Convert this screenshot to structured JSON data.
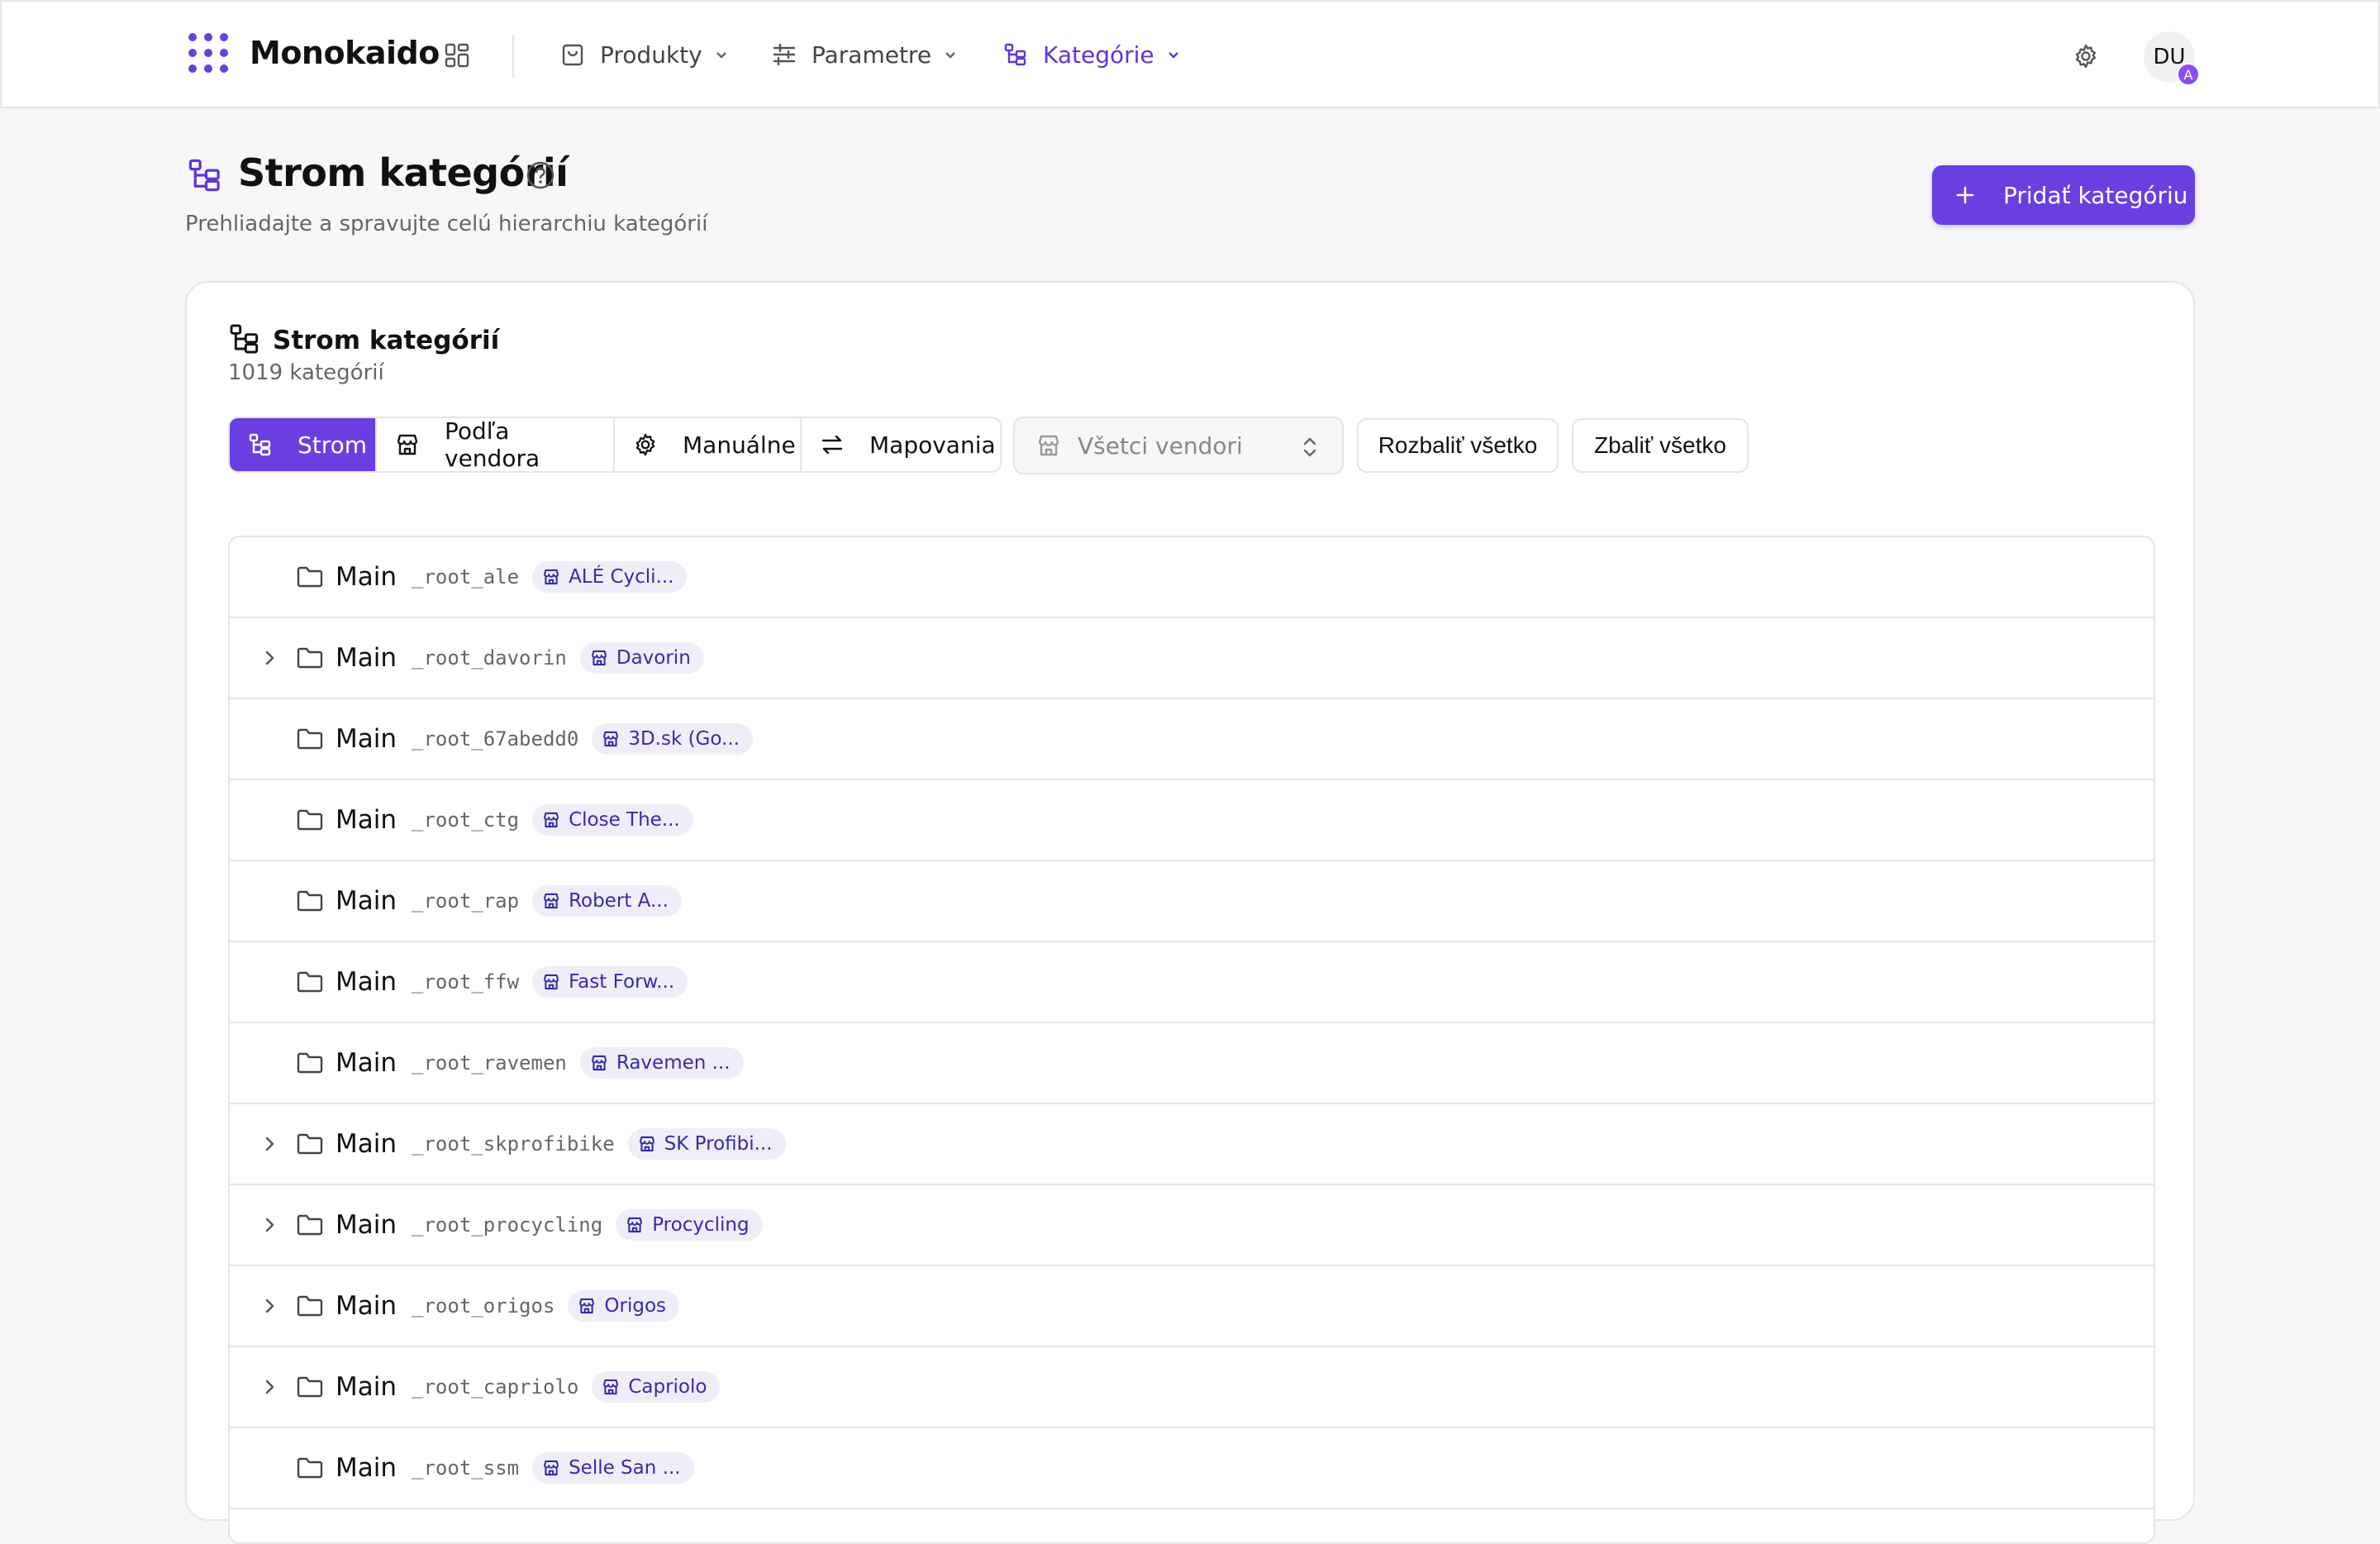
{
  "app": {
    "brand": "Monokaido",
    "colors": {
      "accent": "#6a3fe0",
      "accent_text": "#5b36d6",
      "badge_bg": "#eeeef8",
      "badge_text": "#3a2aa8"
    }
  },
  "nav": {
    "items": [
      {
        "label": "Produkty",
        "icon": "shopping-bag-icon"
      },
      {
        "label": "Parametre",
        "icon": "sliders-icon"
      },
      {
        "label": "Kategórie",
        "icon": "tree-icon",
        "active": true
      }
    ],
    "avatar_initials": "DU",
    "avatar_badge": "A"
  },
  "page": {
    "title": "Strom kategórií",
    "subtitle": "Prehliadajte a spravujte celú hierarchiu kategórií",
    "add_button": "Pridať kategóriu"
  },
  "card": {
    "title": "Strom kategórií",
    "count": "1019 kategórií",
    "view_tabs": [
      {
        "label": "Strom",
        "icon": "tree-icon",
        "active": true
      },
      {
        "label": "Podľa vendora",
        "icon": "store-icon"
      },
      {
        "label": "Manuálne",
        "icon": "gear-icon"
      },
      {
        "label": "Mapovania",
        "icon": "arrows-exchange-icon"
      }
    ],
    "vendor_select": {
      "placeholder": "Všetci vendori"
    },
    "expand_all": "Rozbaliť všetko",
    "collapse_all": "Zbaliť všetko"
  },
  "tree": {
    "rows": [
      {
        "name": "Main",
        "code": "_root_ale",
        "vendor": "ALÉ Cycli...",
        "expandable": false
      },
      {
        "name": "Main",
        "code": "_root_davorin",
        "vendor": "Davorin",
        "expandable": true
      },
      {
        "name": "Main",
        "code": "_root_67abedd0",
        "vendor": "3D.sk (Go...",
        "expandable": false
      },
      {
        "name": "Main",
        "code": "_root_ctg",
        "vendor": "Close The...",
        "expandable": false
      },
      {
        "name": "Main",
        "code": "_root_rap",
        "vendor": "Robert A...",
        "expandable": false
      },
      {
        "name": "Main",
        "code": "_root_ffw",
        "vendor": "Fast Forw...",
        "expandable": false
      },
      {
        "name": "Main",
        "code": "_root_ravemen",
        "vendor": "Ravemen ...",
        "expandable": false
      },
      {
        "name": "Main",
        "code": "_root_skprofibike",
        "vendor": "SK Profibi...",
        "expandable": true
      },
      {
        "name": "Main",
        "code": "_root_procycling",
        "vendor": "Procycling",
        "expandable": true
      },
      {
        "name": "Main",
        "code": "_root_origos",
        "vendor": "Origos",
        "expandable": true
      },
      {
        "name": "Main",
        "code": "_root_capriolo",
        "vendor": "Capriolo",
        "expandable": true
      },
      {
        "name": "Main",
        "code": "_root_ssm",
        "vendor": "Selle San ...",
        "expandable": false
      }
    ]
  }
}
